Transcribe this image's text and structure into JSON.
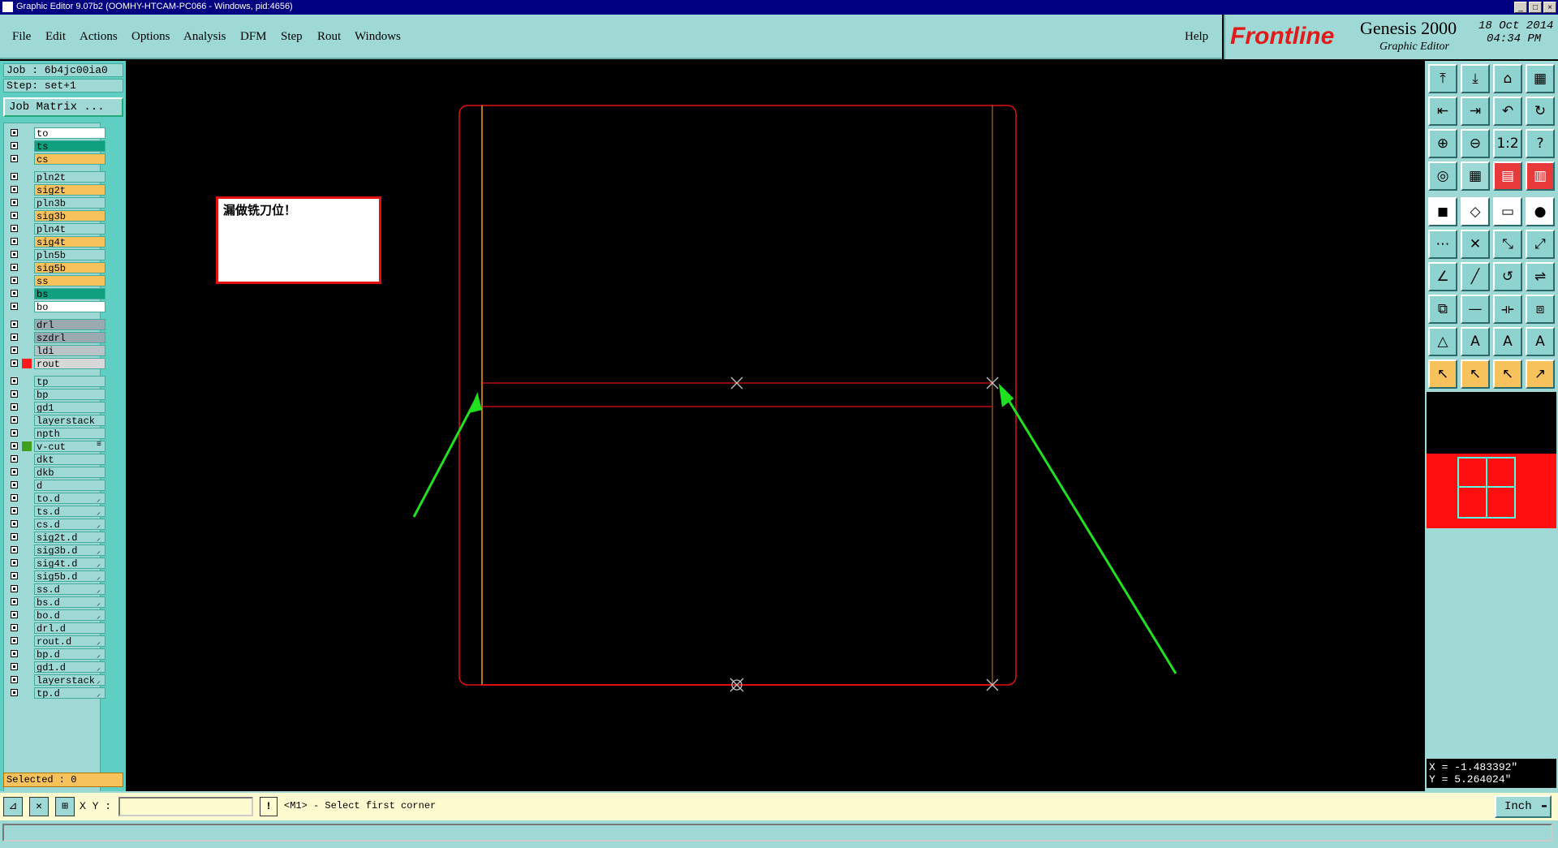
{
  "window": {
    "title": "Graphic Editor 9.07b2 (OOMHY-HTCAM-PC066 - Windows, pid:4656)",
    "controls": [
      "_",
      "□",
      "×"
    ]
  },
  "menu": {
    "items": [
      "File",
      "Edit",
      "Actions",
      "Options",
      "Analysis",
      "DFM",
      "Step",
      "Rout",
      "Windows"
    ],
    "help": "Help"
  },
  "logo": {
    "brand": "Frontline",
    "product": "Genesis 2000",
    "subtitle": "Graphic Editor",
    "date": "18 Oct 2014",
    "time": "04:34 PM"
  },
  "job": {
    "job_label": "Job : 6b4jc00ia0",
    "step_label": "Step: set+1",
    "matrix_button": "Job Matrix ..."
  },
  "layers": [
    {
      "name": "to",
      "color": "#ffffff"
    },
    {
      "name": "ts",
      "color": "#10a080"
    },
    {
      "name": "cs",
      "color": "#f7c15c"
    },
    {
      "name": "pln2t",
      "color": "#9ed9d6"
    },
    {
      "name": "sig2t",
      "color": "#f7c15c"
    },
    {
      "name": "pln3b",
      "color": "#9ed9d6"
    },
    {
      "name": "sig3b",
      "color": "#f7c15c"
    },
    {
      "name": "pln4t",
      "color": "#9ed9d6"
    },
    {
      "name": "sig4t",
      "color": "#f7c15c"
    },
    {
      "name": "pln5b",
      "color": "#9ed9d6"
    },
    {
      "name": "sig5b",
      "color": "#f7c15c"
    },
    {
      "name": "ss",
      "color": "#f7c15c"
    },
    {
      "name": "bs",
      "color": "#10a080"
    },
    {
      "name": "bo",
      "color": "#ffffff"
    },
    {
      "name": "drl",
      "color": "#9aaab0"
    },
    {
      "name": "szdrl",
      "color": "#9aaab0"
    },
    {
      "name": "ldi",
      "color": "#b8c4c8"
    },
    {
      "name": "rout",
      "color": "#d8d8d8",
      "mark": "#ff1a1a"
    },
    {
      "name": "tp",
      "color": "#9ed9d6"
    },
    {
      "name": "bp",
      "color": "#9ed9d6"
    },
    {
      "name": "gd1",
      "color": "#9ed9d6"
    },
    {
      "name": "layerstack",
      "color": "#9ed9d6"
    },
    {
      "name": "npth",
      "color": "#9ed9d6"
    },
    {
      "name": "v-cut",
      "color": "#9ed9d6",
      "mark": "#40a020",
      "icon": "≡"
    },
    {
      "name": "dkt",
      "color": "#9ed9d6"
    },
    {
      "name": "dkb",
      "color": "#9ed9d6"
    },
    {
      "name": "d",
      "color": "#9ed9d6"
    },
    {
      "name": "to.d",
      "color": "#9ed9d6",
      "icon": "⸝"
    },
    {
      "name": "ts.d",
      "color": "#9ed9d6",
      "icon": "⸝"
    },
    {
      "name": "cs.d",
      "color": "#9ed9d6",
      "icon": "⸝"
    },
    {
      "name": "sig2t.d",
      "color": "#9ed9d6",
      "icon": "⸝"
    },
    {
      "name": "sig3b.d",
      "color": "#9ed9d6",
      "icon": "⸝"
    },
    {
      "name": "sig4t.d",
      "color": "#9ed9d6",
      "icon": "⸝"
    },
    {
      "name": "sig5b.d",
      "color": "#9ed9d6",
      "icon": "⸝"
    },
    {
      "name": "ss.d",
      "color": "#9ed9d6",
      "icon": "⸝"
    },
    {
      "name": "bs.d",
      "color": "#9ed9d6",
      "icon": "⸝"
    },
    {
      "name": "bo.d",
      "color": "#9ed9d6",
      "icon": "⸝"
    },
    {
      "name": "drl.d",
      "color": "#9ed9d6"
    },
    {
      "name": "rout.d",
      "color": "#9ed9d6",
      "icon": "⸝"
    },
    {
      "name": "bp.d",
      "color": "#9ed9d6",
      "icon": "⸝"
    },
    {
      "name": "gd1.d",
      "color": "#9ed9d6",
      "icon": "⸝"
    },
    {
      "name": "layerstack",
      "color": "#9ed9d6",
      "icon": "⸝"
    },
    {
      "name": "tp.d",
      "color": "#9ed9d6",
      "icon": "⸝"
    }
  ],
  "selected_label": "Selected : 0",
  "annotation": {
    "text": "漏做铣刀位！"
  },
  "coords": {
    "x_label": "X = -1.483392\"",
    "y_label": "Y = 5.264024\""
  },
  "status": {
    "xy_label": "X Y :",
    "xy_value": "",
    "prompt": "<M1> - Select first corner",
    "unit": "Inch"
  },
  "tools": [
    "fit-icon",
    "zoom-icon",
    "home-icon",
    "window-icon",
    "pan-left-icon",
    "pan-right-icon",
    "undo-view-icon",
    "redraw-icon",
    "zoom-in-icon",
    "zoom-out-icon",
    "scale-1-2-icon",
    "help-icon",
    "snap-icon",
    "grid-icon",
    "layers-red-icon",
    "properties-red-icon",
    "pad-icon",
    "polygon-icon",
    "ruler-icon",
    "circle-icon",
    "connect-icon",
    "delete-icon",
    "move-icon",
    "move-red-icon",
    "line-red-icon",
    "diagonal-icon",
    "rotate-icon",
    "mirror-icon",
    "copy-icon",
    "cut-icon",
    "stretch-icon",
    "transform-icon",
    "text-icon",
    "text-a-icon",
    "text-a-filled-icon",
    "text-a-arc-icon",
    "select-icon",
    "select-box-icon",
    "select-touch-icon",
    "select-net-icon"
  ],
  "tool_glyphs": [
    "⤒",
    "⤓",
    "⌂",
    "▦",
    "⇤",
    "⇥",
    "↶",
    "↻",
    "⊕",
    "⊖",
    "1:2",
    "?",
    "◎",
    "▦",
    "▤",
    "▥",
    "◼",
    "◇",
    "▭",
    "●",
    "⋯",
    "✕",
    "⤡",
    "⤢",
    "∠",
    "╱",
    "↺",
    "⇌",
    "⧉",
    "—",
    "⟛",
    "⧈",
    "△",
    "A",
    "A",
    "A",
    "↖",
    "↖",
    "↖",
    "↗"
  ]
}
